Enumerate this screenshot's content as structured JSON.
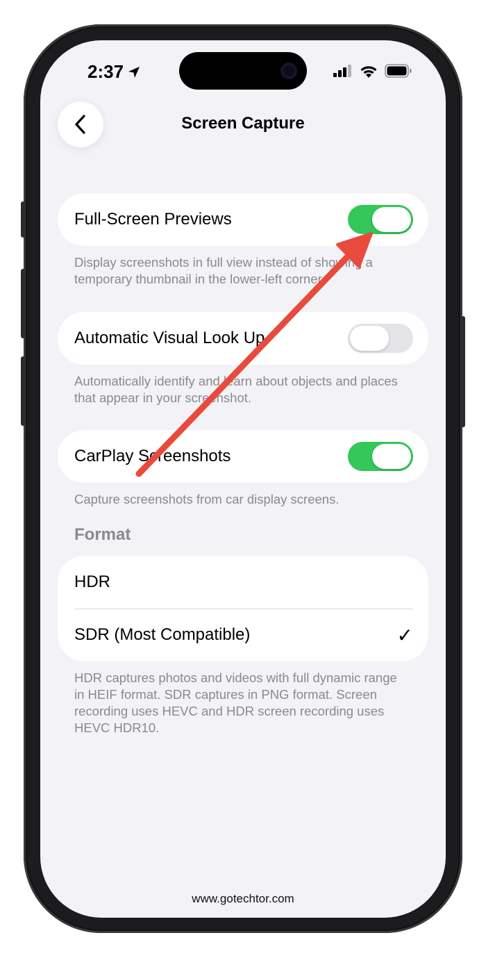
{
  "status_bar": {
    "time": "2:37"
  },
  "nav": {
    "title": "Screen Capture"
  },
  "settings": [
    {
      "label": "Full-Screen Previews",
      "enabled": true,
      "description": "Display screenshots in full view instead of showing a temporary thumbnail in the lower-left corner."
    },
    {
      "label": "Automatic Visual Look Up",
      "enabled": false,
      "description": "Automatically identify and learn about objects and places that appear in your screenshot."
    },
    {
      "label": "CarPlay Screenshots",
      "enabled": true,
      "description": "Capture screenshots from car display screens."
    }
  ],
  "format": {
    "header": "Format",
    "options": [
      {
        "label": "HDR",
        "selected": false
      },
      {
        "label": "SDR (Most Compatible)",
        "selected": true
      }
    ],
    "check_glyph": "✓",
    "description": "HDR captures photos and videos with full dynamic range in HEIF format. SDR captures in PNG format. Screen recording uses HEVC and HDR screen recording uses HEVC HDR10."
  },
  "watermark": "www.gotechtor.com",
  "colors": {
    "toggle_on": "#34c759",
    "toggle_off": "#e3e3e8",
    "annotation_arrow": "#e84b3c"
  },
  "icons": {
    "back": "chevron-left-icon",
    "location": "location-arrow-icon",
    "signal": "cellular-signal-icon",
    "wifi": "wifi-icon",
    "battery": "battery-icon"
  }
}
